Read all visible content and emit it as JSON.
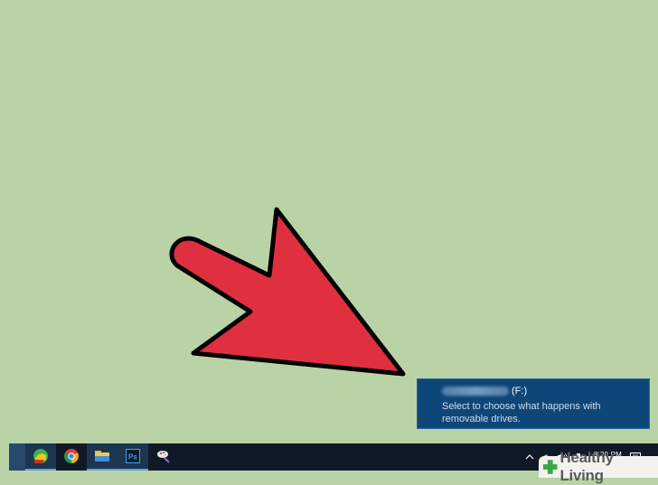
{
  "notification": {
    "drive_letter": "(F:)",
    "message": "Select to choose what happens with removable drives."
  },
  "taskbar": {
    "apps": [
      {
        "name": "maps-app",
        "icon": "globe-map-icon",
        "active": true
      },
      {
        "name": "chrome",
        "icon": "chrome-icon",
        "active": false
      },
      {
        "name": "file-explorer",
        "icon": "folder-icon",
        "active": true
      },
      {
        "name": "photoshop",
        "icon": "photoshop-icon",
        "active": true
      },
      {
        "name": "paint",
        "icon": "paint-icon",
        "active": false
      }
    ],
    "clock": "8:20 PM"
  },
  "watermark": {
    "text": "Healthy Living"
  },
  "colors": {
    "desktop": "#b9d3a7",
    "arrow_fill": "#e03040",
    "toast_bg": "#0e4677",
    "taskbar_bg": "#101a26"
  }
}
